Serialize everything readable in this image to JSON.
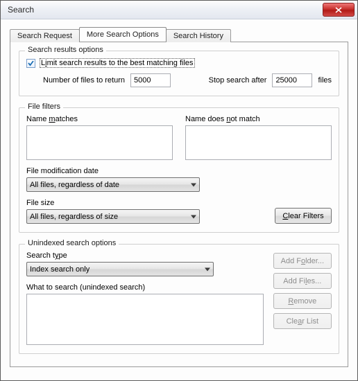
{
  "window": {
    "title": "Search"
  },
  "tabs": {
    "request": "Search Request",
    "more": "More Search Options",
    "history": "Search History"
  },
  "results": {
    "group": "Search results options",
    "limit_pre": "L",
    "limit_u": "i",
    "limit_post": "mit search results to the best matching files",
    "limit_checked": true,
    "num_label": "Number of files to return",
    "num_value": "5000",
    "stop_label": "Stop search after",
    "stop_value": "25000",
    "files_label": "files"
  },
  "filters": {
    "group": "File filters",
    "name_match_pre": "Name ",
    "name_match_u": "m",
    "name_match_post": "atches",
    "name_not_pre": "Name does ",
    "name_not_u": "n",
    "name_not_post": "ot match",
    "mod_date_label": "File modification date",
    "mod_date_value": "All files, regardless of date",
    "size_label": "File size",
    "size_value": "All files, regardless of size",
    "clear_pre": "",
    "clear_u": "C",
    "clear_post": "lear Filters"
  },
  "unindexed": {
    "group": "Unindexed search options",
    "type_pre": "Search t",
    "type_u": "y",
    "type_post": "pe",
    "type_value": "Index search only",
    "what_label": "What to search (unindexed search)",
    "add_folder_pre": "Add F",
    "add_folder_u": "o",
    "add_folder_post": "lder...",
    "add_files_pre": "Add Fi",
    "add_files_u": "l",
    "add_files_post": "es...",
    "remove_pre": "",
    "remove_u": "R",
    "remove_post": "emove",
    "clear_list_pre": "Cle",
    "clear_list_u": "a",
    "clear_list_post": "r List"
  }
}
